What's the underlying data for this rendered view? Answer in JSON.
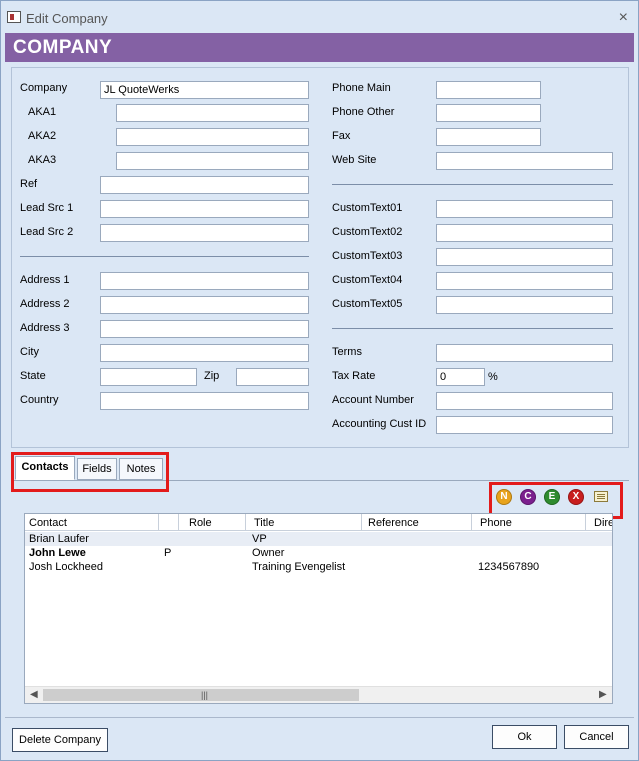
{
  "window": {
    "title": "Edit Company",
    "close_glyph": "×",
    "icon": "app-icon"
  },
  "banner": {
    "text": "COMPANY"
  },
  "form": {
    "left": {
      "company": {
        "label": "Company",
        "value": "JL QuoteWerks"
      },
      "aka1": {
        "label": "AKA1",
        "value": ""
      },
      "aka2": {
        "label": "AKA2",
        "value": ""
      },
      "aka3": {
        "label": "AKA3",
        "value": ""
      },
      "ref": {
        "label": "Ref",
        "value": ""
      },
      "lead_src_1": {
        "label": "Lead Src 1",
        "value": ""
      },
      "lead_src_2": {
        "label": "Lead Src 2",
        "value": ""
      },
      "address1": {
        "label": "Address 1",
        "value": ""
      },
      "address2": {
        "label": "Address 2",
        "value": ""
      },
      "address3": {
        "label": "Address 3",
        "value": ""
      },
      "city": {
        "label": "City",
        "value": ""
      },
      "state": {
        "label": "State",
        "value": ""
      },
      "zip": {
        "label": "Zip",
        "value": ""
      },
      "country": {
        "label": "Country",
        "value": ""
      }
    },
    "right": {
      "phone_main": {
        "label": "Phone Main",
        "value": ""
      },
      "phone_other": {
        "label": "Phone Other",
        "value": ""
      },
      "fax": {
        "label": "Fax",
        "value": ""
      },
      "web_site": {
        "label": "Web Site",
        "value": ""
      },
      "custom1": {
        "label": "CustomText01",
        "value": ""
      },
      "custom2": {
        "label": "CustomText02",
        "value": ""
      },
      "custom3": {
        "label": "CustomText03",
        "value": ""
      },
      "custom4": {
        "label": "CustomText04",
        "value": ""
      },
      "custom5": {
        "label": "CustomText05",
        "value": ""
      },
      "terms": {
        "label": "Terms",
        "value": ""
      },
      "tax_rate": {
        "label": "Tax Rate",
        "value": "0",
        "unit": "%"
      },
      "account_number": {
        "label": "Account Number",
        "value": ""
      },
      "accounting_cust_id": {
        "label": "Accounting Cust ID",
        "value": ""
      }
    }
  },
  "tabs": [
    {
      "label": "Contacts",
      "active": true
    },
    {
      "label": "Fields",
      "active": false
    },
    {
      "label": "Notes",
      "active": false
    }
  ],
  "contact_toolbar": {
    "new": {
      "letter": "N",
      "color": "#e8a31c"
    },
    "copy": {
      "letter": "C",
      "color": "#7b1f8e"
    },
    "edit": {
      "letter": "E",
      "color": "#2e8b2e"
    },
    "delete": {
      "letter": "X",
      "color": "#c81e1e"
    },
    "email_icon": "mail-icon"
  },
  "contacts_grid": {
    "columns": [
      "Contact",
      "Role",
      "Title",
      "Reference",
      "Phone",
      "Dire"
    ],
    "rows": [
      {
        "contact": "Brian Laufer",
        "role": "",
        "title": "VP",
        "reference": "",
        "phone": "",
        "bold": false
      },
      {
        "contact": "John Lewe",
        "role": "P",
        "title": "Owner",
        "reference": "",
        "phone": "",
        "bold": true
      },
      {
        "contact": "Josh Lockheed",
        "role": "",
        "title": "Training Evengelist",
        "reference": "",
        "phone": "1234567890",
        "bold": false
      }
    ],
    "scroll_left": "◀",
    "scroll_right": "▶",
    "scroll_grip": "|||"
  },
  "footer": {
    "delete_label": "Delete Company",
    "ok_label": "Ok",
    "cancel_label": "Cancel"
  }
}
